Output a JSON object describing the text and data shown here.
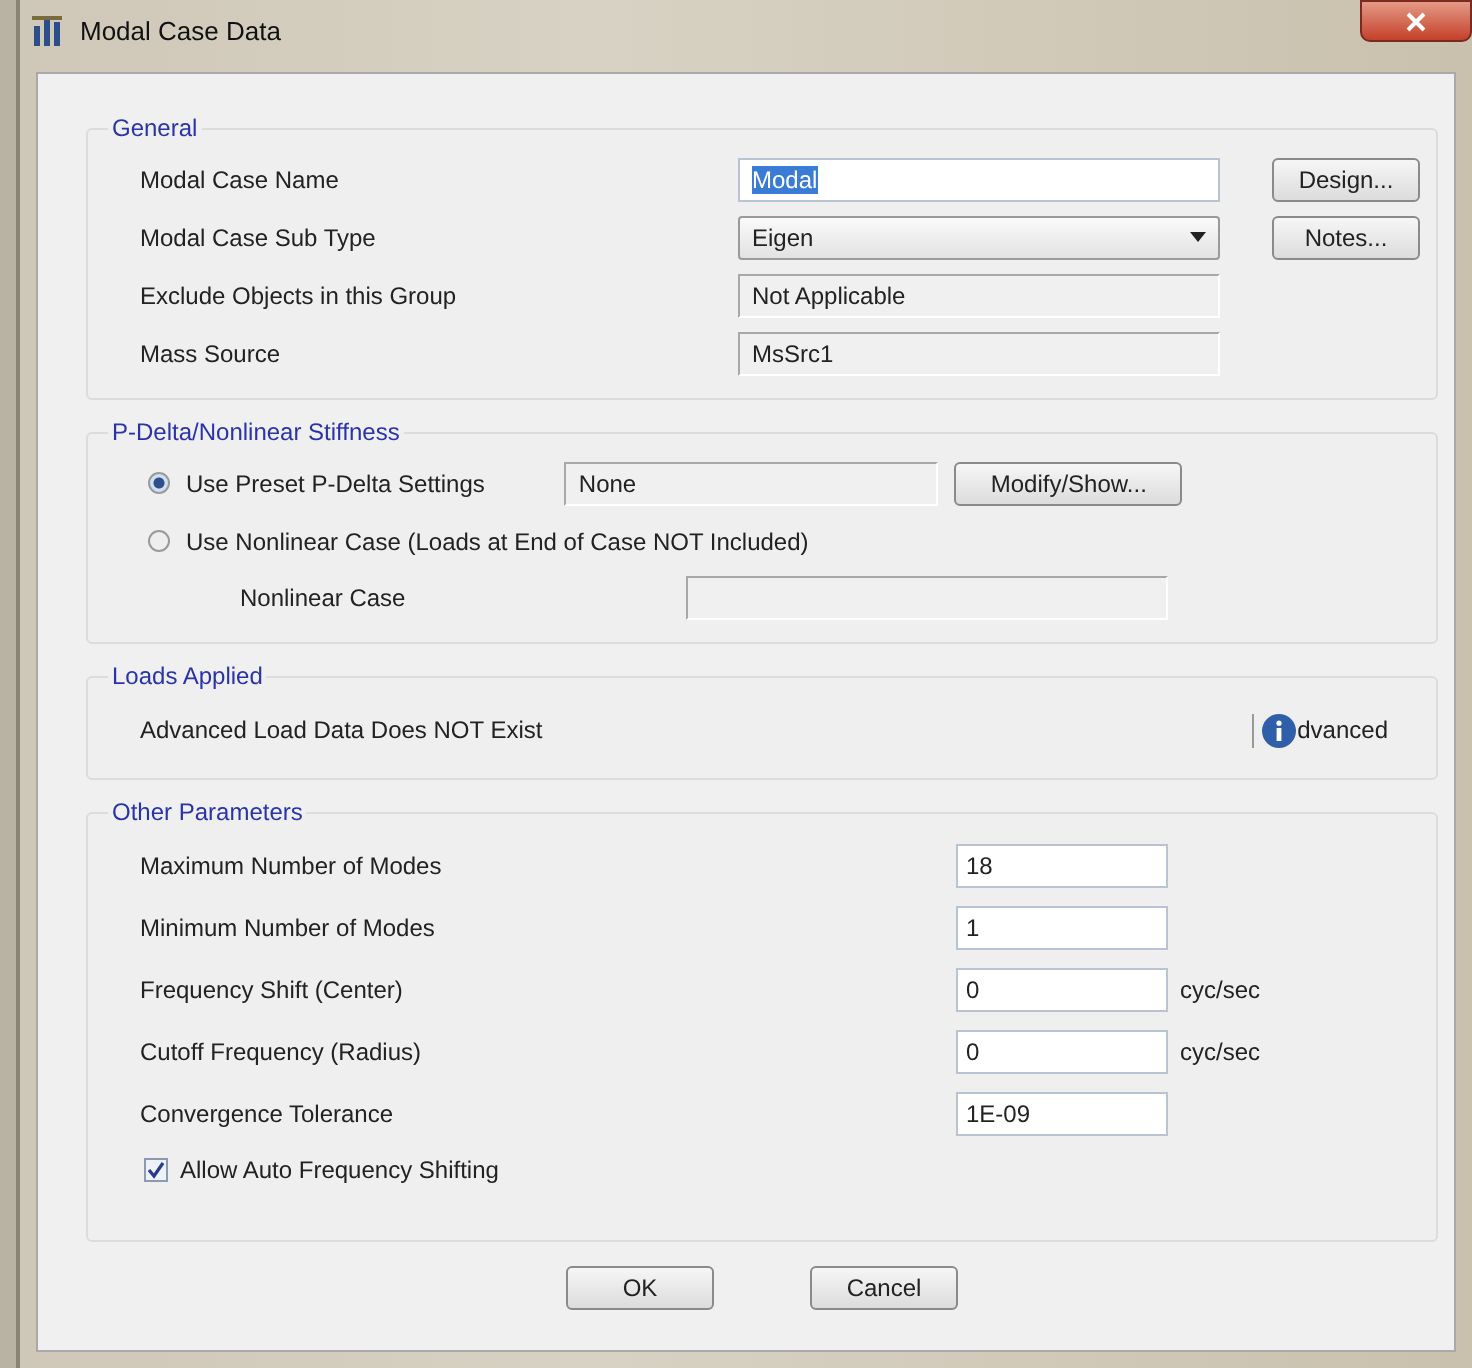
{
  "window": {
    "title": "Modal Case Data"
  },
  "general": {
    "title": "General",
    "fields": [
      {
        "label": "Modal Case Name",
        "kind": "input",
        "value": "Modal",
        "text_selected": true,
        "button": "Design..."
      },
      {
        "label": "Modal Case Sub Type",
        "kind": "dropdown",
        "value": "Eigen",
        "button": "Notes..."
      },
      {
        "label": "Exclude Objects in this Group",
        "kind": "readonly",
        "value": "Not Applicable"
      },
      {
        "label": "Mass Source",
        "kind": "readonly",
        "value": "MsSrc1"
      }
    ]
  },
  "pdelta": {
    "title": "P-Delta/Nonlinear Stiffness",
    "options": [
      {
        "label": "Use Preset P-Delta Settings",
        "selected": true,
        "value": "None",
        "button": "Modify/Show..."
      },
      {
        "label": "Use Nonlinear Case  (Loads at End of Case NOT Included)",
        "selected": false
      }
    ],
    "nonlinear_case": {
      "label": "Nonlinear Case"
    }
  },
  "loads": {
    "title": "Loads Applied",
    "message": "Advanced Load Data Does NOT Exist",
    "button": "dvanced"
  },
  "other": {
    "title": "Other Parameters",
    "fields": [
      {
        "label": "Maximum Number of Modes",
        "value": "18"
      },
      {
        "label": "Minimum Number of Modes",
        "value": "1"
      },
      {
        "label": "Frequency Shift  (Center)",
        "value": "0",
        "unit": "cyc/sec"
      },
      {
        "label": "Cutoff Frequency  (Radius)",
        "value": "0",
        "unit": "cyc/sec"
      },
      {
        "label": "Convergence Tolerance",
        "value": "1E-09"
      }
    ],
    "checkbox": {
      "label": "Allow Auto Frequency Shifting",
      "checked": true
    }
  },
  "buttons": [
    "OK",
    "Cancel"
  ]
}
